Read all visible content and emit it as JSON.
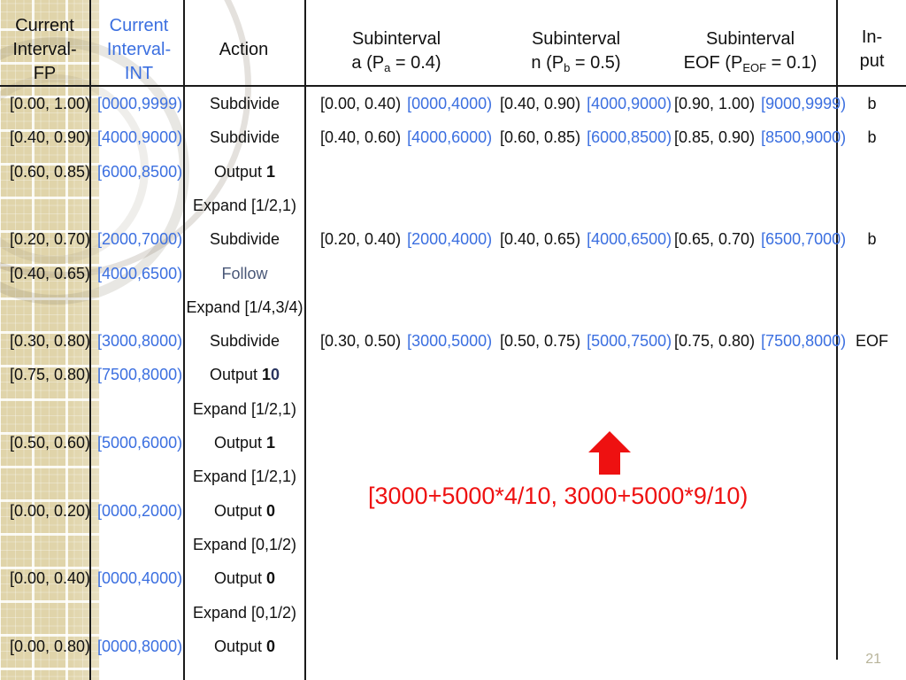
{
  "slide": {
    "page_number": "21"
  },
  "table": {
    "headers": {
      "fp": [
        "Current",
        "Interval-",
        "FP"
      ],
      "int": [
        "Current",
        "Interval-",
        "INT"
      ],
      "action": "Action",
      "sub_a": {
        "line1": "Subinterval",
        "line2_pre": "a   (P",
        "line2_sub": "a",
        "line2_post": " = 0.4)"
      },
      "sub_n": {
        "line1": "Subinterval",
        "line2_pre": "n (P",
        "line2_sub": "b",
        "line2_post": " = 0.5)"
      },
      "sub_eof": {
        "line1": "Subinterval",
        "line2_pre": "EOF (P",
        "line2_sub": "EOF",
        "line2_post": " = 0.1)"
      },
      "input": [
        "In-",
        "put"
      ]
    },
    "rows": [
      {
        "fp": "[0.00, 1.00)",
        "int": "[0000,9999)",
        "action": "Subdivide",
        "action_suffix": "",
        "sub_a_fp": "[0.00, 0.40)",
        "sub_a_int": "[0000,4000)",
        "sub_n_fp": "[0.40, 0.90)",
        "sub_n_int": "[4000,9000)",
        "sub_eof_fp": "[0.90, 1.00)",
        "sub_eof_int": "[9000,9999)",
        "input": "b"
      },
      {
        "fp": "[0.40, 0.90)",
        "int": "[4000,9000)",
        "action": "Subdivide",
        "action_suffix": "",
        "sub_a_fp": "[0.40, 0.60)",
        "sub_a_int": "[4000,6000)",
        "sub_n_fp": "[0.60, 0.85)",
        "sub_n_int": "[6000,8500)",
        "sub_eof_fp": "[0.85, 0.90)",
        "sub_eof_int": "[8500,9000)",
        "input": "b"
      },
      {
        "fp": "[0.60, 0.85)",
        "int": "[6000,8500)",
        "action": "Output ",
        "action_suffix": "1",
        "sub_a_fp": "",
        "sub_a_int": "",
        "sub_n_fp": "",
        "sub_n_int": "",
        "sub_eof_fp": "",
        "sub_eof_int": "",
        "input": ""
      },
      {
        "fp": "",
        "int": "",
        "action": "Expand [1/2,1)",
        "action_suffix": "",
        "sub_a_fp": "",
        "sub_a_int": "",
        "sub_n_fp": "",
        "sub_n_int": "",
        "sub_eof_fp": "",
        "sub_eof_int": "",
        "input": ""
      },
      {
        "fp": "[0.20, 0.70)",
        "int": "[2000,7000)",
        "action": "Subdivide",
        "action_suffix": "",
        "sub_a_fp": "[0.20, 0.40)",
        "sub_a_int": "[2000,4000)",
        "sub_n_fp": "[0.40, 0.65)",
        "sub_n_int": "[4000,6500)",
        "sub_eof_fp": "[0.65, 0.70)",
        "sub_eof_int": "[6500,7000)",
        "input": "b"
      },
      {
        "fp": "[0.40, 0.65)",
        "int": "[4000,6500)",
        "action": "Follow",
        "action_suffix": "",
        "sub_a_fp": "",
        "sub_a_int": "",
        "sub_n_fp": "",
        "sub_n_int": "",
        "sub_eof_fp": "",
        "sub_eof_int": "",
        "input": ""
      },
      {
        "fp": "",
        "int": "",
        "action": "Expand [1/4,3/4)",
        "action_suffix": "",
        "sub_a_fp": "",
        "sub_a_int": "",
        "sub_n_fp": "",
        "sub_n_int": "",
        "sub_eof_fp": "",
        "sub_eof_int": "",
        "input": ""
      },
      {
        "fp": "[0.30, 0.80)",
        "int": "[3000,8000)",
        "action": "Subdivide",
        "action_suffix": "",
        "sub_a_fp": "[0.30, 0.50)",
        "sub_a_int": "[3000,5000)",
        "sub_n_fp": "[0.50, 0.75)",
        "sub_n_int": "[5000,7500)",
        "sub_eof_fp": "[0.75, 0.80)",
        "sub_eof_int": "[7500,8000)",
        "input": "EOF"
      },
      {
        "fp": "[0.75, 0.80)",
        "int": "[7500,8000)",
        "action": "Output ",
        "action_suffix": "10",
        "sub_a_fp": "",
        "sub_a_int": "",
        "sub_n_fp": "",
        "sub_n_int": "",
        "sub_eof_fp": "",
        "sub_eof_int": "",
        "input": ""
      },
      {
        "fp": "",
        "int": "",
        "action": "Expand [1/2,1)",
        "action_suffix": "",
        "sub_a_fp": "",
        "sub_a_int": "",
        "sub_n_fp": "",
        "sub_n_int": "",
        "sub_eof_fp": "",
        "sub_eof_int": "",
        "input": ""
      },
      {
        "fp": "[0.50, 0.60)",
        "int": "[5000,6000)",
        "action": "Output ",
        "action_suffix": "1",
        "sub_a_fp": "",
        "sub_a_int": "",
        "sub_n_fp": "",
        "sub_n_int": "",
        "sub_eof_fp": "",
        "sub_eof_int": "",
        "input": ""
      },
      {
        "fp": "",
        "int": "",
        "action": "Expand [1/2,1)",
        "action_suffix": "",
        "sub_a_fp": "",
        "sub_a_int": "",
        "sub_n_fp": "",
        "sub_n_int": "",
        "sub_eof_fp": "",
        "sub_eof_int": "",
        "input": ""
      },
      {
        "fp": "[0.00, 0.20)",
        "int": "[0000,2000)",
        "action": "Output ",
        "action_suffix": "0",
        "sub_a_fp": "",
        "sub_a_int": "",
        "sub_n_fp": "",
        "sub_n_int": "",
        "sub_eof_fp": "",
        "sub_eof_int": "",
        "input": ""
      },
      {
        "fp": "",
        "int": "",
        "action": "Expand [0,1/2)",
        "action_suffix": "",
        "sub_a_fp": "",
        "sub_a_int": "",
        "sub_n_fp": "",
        "sub_n_int": "",
        "sub_eof_fp": "",
        "sub_eof_int": "",
        "input": ""
      },
      {
        "fp": "[0.00, 0.40)",
        "int": "[0000,4000)",
        "action": "Output ",
        "action_suffix": "0",
        "sub_a_fp": "",
        "sub_a_int": "",
        "sub_n_fp": "",
        "sub_n_int": "",
        "sub_eof_fp": "",
        "sub_eof_int": "",
        "input": ""
      },
      {
        "fp": "",
        "int": "",
        "action": "Expand [0,1/2)",
        "action_suffix": "",
        "sub_a_fp": "",
        "sub_a_int": "",
        "sub_n_fp": "",
        "sub_n_int": "",
        "sub_eof_fp": "",
        "sub_eof_int": "",
        "input": ""
      },
      {
        "fp": "[0.00, 0.80)",
        "int": "[0000,8000)",
        "action": "Output ",
        "action_suffix": "0",
        "sub_a_fp": "",
        "sub_a_int": "",
        "sub_n_fp": "",
        "sub_n_int": "",
        "sub_eof_fp": "",
        "sub_eof_int": "",
        "input": ""
      }
    ]
  },
  "annotation": {
    "text": "[3000+5000*4/10, 3000+5000*9/10)",
    "color": "#ee1111",
    "arrow": "up-arrow-icon"
  }
}
